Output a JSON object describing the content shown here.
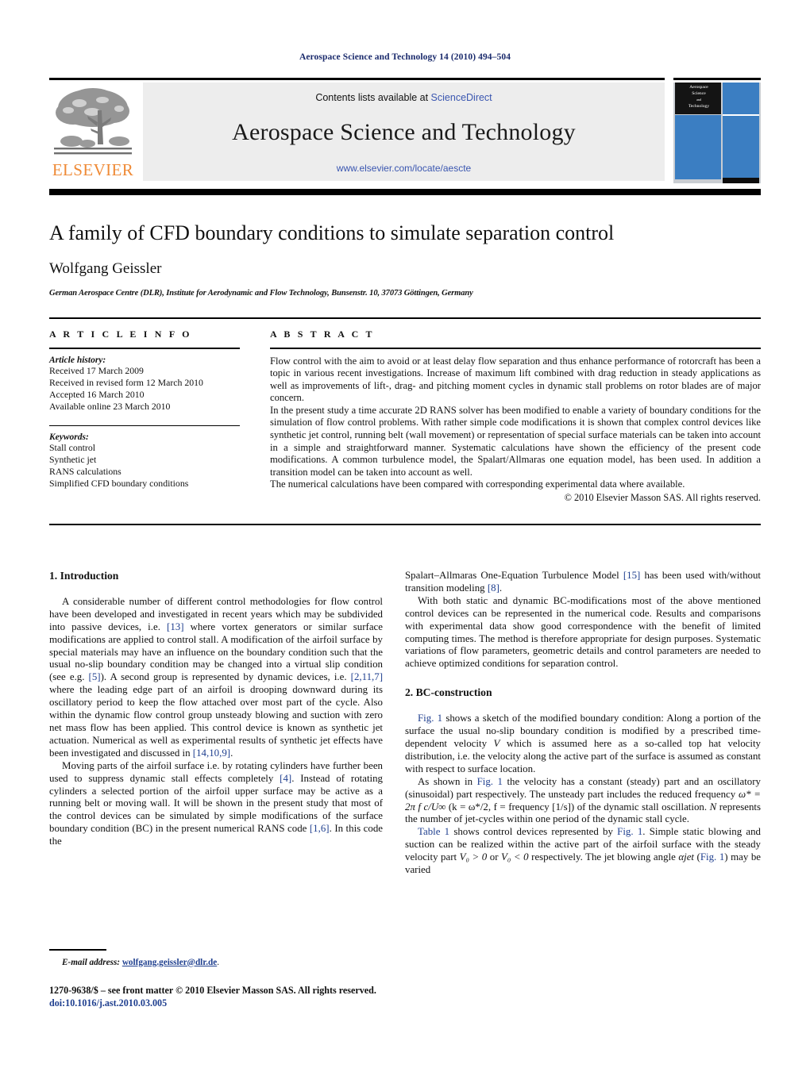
{
  "running_head": "Aerospace Science and Technology 14 (2010) 494–504",
  "masthead": {
    "contents_prefix": "Contents lists available at ",
    "sciencedirect_link": "ScienceDirect",
    "journal_title": "Aerospace Science and Technology",
    "journal_url": "www.elsevier.com/locate/aescte",
    "publisher_wordmark": "ELSEVIER",
    "cover_title_lines": [
      "Aerospace",
      "Science",
      "and",
      "Technology"
    ],
    "accent_color": "#3a56b0",
    "elsevier_orange": "#ef8a36",
    "cover_blue": "#3b7ec2"
  },
  "title_block": {
    "title": "A family of CFD boundary conditions to simulate separation control",
    "author": "Wolfgang Geissler",
    "affiliation": "German Aerospace Centre (DLR), Institute for Aerodynamic and Flow Technology, Bunsenstr. 10, 37073 Göttingen, Germany"
  },
  "article_info": {
    "heading": "A R T I C L E    I N F O",
    "history_label": "Article history:",
    "history": [
      "Received 17 March 2009",
      "Received in revised form 12 March 2010",
      "Accepted 16 March 2010",
      "Available online 23 March 2010"
    ],
    "keywords_label": "Keywords:",
    "keywords": [
      "Stall control",
      "Synthetic jet",
      "RANS calculations",
      "Simplified CFD boundary conditions"
    ]
  },
  "abstract": {
    "heading": "A B S T R A C T",
    "paragraphs": [
      "Flow control with the aim to avoid or at least delay flow separation and thus enhance performance of rotorcraft has been a topic in various recent investigations. Increase of maximum lift combined with drag reduction in steady applications as well as improvements of lift-, drag- and pitching moment cycles in dynamic stall problems on rotor blades are of major concern.",
      "In the present study a time accurate 2D RANS solver has been modified to enable a variety of boundary conditions for the simulation of flow control problems. With rather simple code modifications it is shown that complex control devices like synthetic jet control, running belt (wall movement) or representation of special surface materials can be taken into account in a simple and straightforward manner. Systematic calculations have shown the efficiency of the present code modifications. A common turbulence model, the Spalart/Allmaras one equation model, has been used. In addition a transition model can be taken into account as well.",
      "The numerical calculations have been compared with corresponding experimental data where available."
    ],
    "copyright": "© 2010 Elsevier Masson SAS. All rights reserved."
  },
  "body": {
    "left": {
      "section_heading": "1. Introduction",
      "paragraph_1_a": "A considerable number of different control methodologies for flow control have been developed and investigated in recent years which may be subdivided into passive devices, i.e. ",
      "ref_13": "[13]",
      "paragraph_1_b": " where vortex generators or similar surface modifications are applied to control stall. A modification of the airfoil surface by special materials may have an influence on the boundary condition such that the usual no-slip boundary condition may be changed into a virtual slip condition (see e.g. ",
      "ref_5": "[5]",
      "paragraph_1_c": "). A second group is represented by dynamic devices, i.e. ",
      "ref_2117": "[2,11,7]",
      "paragraph_1_d": " where the leading edge part of an airfoil is drooping downward during its oscillatory period to keep the flow attached over most part of the cycle. Also within the dynamic flow control group unsteady blowing and suction with zero net mass flow has been applied. This control device is known as synthetic jet actuation. Numerical as well as experimental results of synthetic jet effects have been investigated and discussed in ",
      "ref_14109": "[14,10,9]",
      "paragraph_1_e": ".",
      "paragraph_2_a": "Moving parts of the airfoil surface i.e. by rotating cylinders have further been used to suppress dynamic stall effects completely ",
      "ref_4": "[4]",
      "paragraph_2_b": ". Instead of rotating cylinders a selected portion of the airfoil upper surface may be active as a running belt or moving wall. It will be shown in the present study that most of the control devices can be simulated by simple modifications of the surface boundary condition (BC) in the present numerical RANS code ",
      "ref_16": "[1,6]",
      "paragraph_2_c": ". In this code the"
    },
    "right": {
      "cont_a": "Spalart–Allmaras One-Equation Turbulence Model ",
      "ref_15": "[15]",
      "cont_b": " has been used with/without transition modeling ",
      "ref_8": "[8]",
      "cont_c": ".",
      "paragraph_1": "With both static and dynamic BC-modifications most of the above mentioned control devices can be represented in the numerical code. Results and comparisons with experimental data show good correspondence with the benefit of limited computing times. The method is therefore appropriate for design purposes. Systematic variations of flow parameters, geometric details and control parameters are needed to achieve optimized conditions for separation control.",
      "section_heading": "2. BC-construction",
      "fig1_ref": "Fig. 1",
      "paragraph_2_b": " shows a sketch of the modified boundary condition: Along a portion of the surface the usual no-slip boundary condition is modified by a prescribed time-dependent velocity ",
      "velocity_symbol": "V",
      "paragraph_2_c": " which is assumed here as a so-called top hat velocity distribution, i.e. the velocity along the active part of the surface is assumed as constant with respect to surface location.",
      "paragraph_3_a": "As shown in ",
      "paragraph_3_b": " the velocity has a constant (steady) part and an oscillatory (sinusoidal) part respectively. The unsteady part includes the reduced frequency ",
      "freq_formula": "ω* = 2π f c/U∞",
      "paragraph_3_c": " (k = ω*/2, f = frequency [1/s]) of the dynamic stall oscillation. ",
      "n_symbol": "N",
      "paragraph_3_d": " represents the number of jet-cycles within one period of the dynamic stall cycle.",
      "table1_ref": "Table 1",
      "paragraph_4_a": " shows control devices represented by ",
      "paragraph_4_b": ". Simple static blowing and suction can be realized within the active part of the airfoil surface with the steady velocity part ",
      "v0_gt": "V₀ > 0",
      "paragraph_4_c": " or ",
      "v0_lt": "V₀ < 0",
      "paragraph_4_d": " respectively. The jet blowing angle ",
      "alpha_jet": "αjet",
      "paragraph_4_e": " (",
      "paragraph_4_f": ") may be varied"
    }
  },
  "footnote": {
    "label": "E-mail address:",
    "email": "wolfgang.geissler@dlr.de",
    "trailing": "."
  },
  "frontmatter": {
    "line1": "1270-9638/$ – see front matter © 2010 Elsevier Masson SAS. All rights reserved.",
    "doi": "doi:10.1016/j.ast.2010.03.005"
  }
}
